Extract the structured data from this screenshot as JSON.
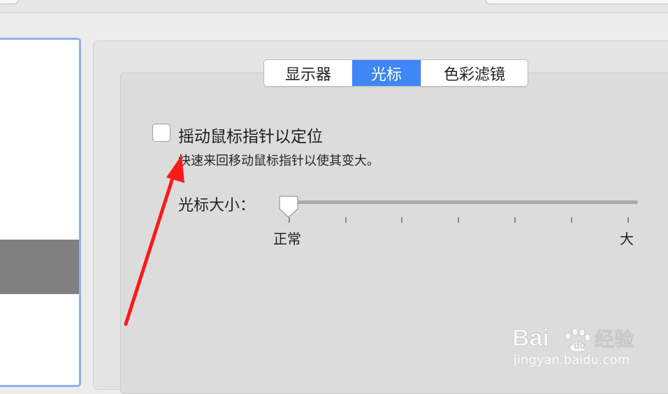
{
  "tabs": [
    {
      "label": "显示器",
      "active": false
    },
    {
      "label": "光标",
      "active": true
    },
    {
      "label": "色彩滤镜",
      "active": false
    }
  ],
  "shake_option": {
    "label": "摇动鼠标指针以定位",
    "description": "快速来回移动鼠标指针以使其变大。",
    "checked": false
  },
  "cursor_size": {
    "label": "光标大小：",
    "min_label": "正常",
    "max_label": "大",
    "value_fraction": 0
  },
  "watermark": {
    "text": "jingyan.baidu.com"
  },
  "colors": {
    "accent": "#3f86f6",
    "sidebar_border": "#8fb0ec",
    "arrow": "#ff1a1a"
  },
  "icons": {
    "annotation": "red-arrow-icon",
    "watermark": "baidu-paw-logo"
  }
}
